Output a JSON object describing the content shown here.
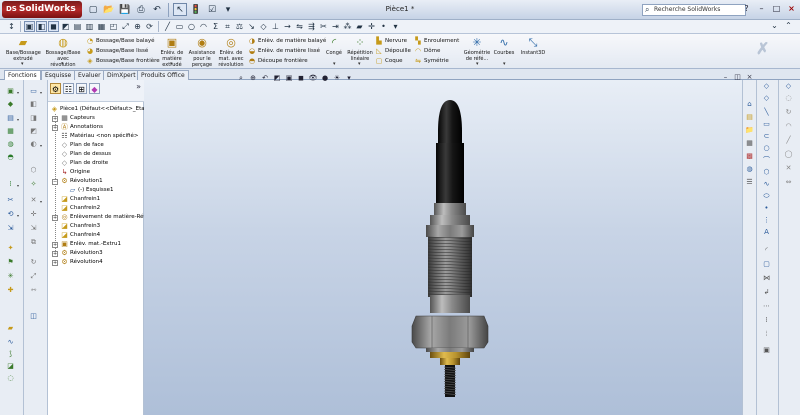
{
  "app": {
    "logo_text": "SolidWorks",
    "logo_mark": "DS",
    "document_title": "Pièce1 *",
    "search_placeholder": "Recherche SolidWorks",
    "window_buttons": {
      "help": "?",
      "minimize": "–",
      "restore": "□",
      "close": "×"
    }
  },
  "ribbon": {
    "big_buttons": [
      {
        "id": "boss-extrude",
        "label": "Base/Bossage extrudé",
        "icon": "boss-extrude-icon"
      },
      {
        "id": "boss-revolve",
        "label": "Bossage/Base avec révolution",
        "icon": "boss-revolve-icon"
      },
      {
        "id": "cut-extrude",
        "label": "Enlév. de matière extrudé",
        "icon": "cut-extrude-icon"
      },
      {
        "id": "hole-wizard",
        "label": "Assistance pour le perçage",
        "icon": "hole-wizard-icon"
      },
      {
        "id": "cut-revolve",
        "label": "Enlèv. de mat. avec révolution",
        "icon": "cut-revolve-icon"
      },
      {
        "id": "fillet",
        "label": "Congé",
        "icon": "fillet-icon"
      },
      {
        "id": "linear-pattern",
        "label": "Répétition linéaire",
        "icon": "linear-pattern-icon"
      },
      {
        "id": "ref-geometry",
        "label": "Géométrie de réfé...",
        "icon": "ref-geometry-icon"
      },
      {
        "id": "curves",
        "label": "Courbes",
        "icon": "curves-icon"
      },
      {
        "id": "instant3d",
        "label": "Instant3D",
        "icon": "instant3d-icon"
      }
    ],
    "small_buttons": [
      {
        "id": "boss-sweep",
        "label": "Bossage/Base balayé"
      },
      {
        "id": "boss-loft",
        "label": "Bossage/Base lissé"
      },
      {
        "id": "boss-boundary",
        "label": "Bossage/Base frontière"
      },
      {
        "id": "cut-sweep",
        "label": "Enlèv. de matière balayé"
      },
      {
        "id": "cut-loft",
        "label": "Enlèv. de matière lissé"
      },
      {
        "id": "cut-boundary",
        "label": "Découpe frontière"
      },
      {
        "id": "rib",
        "label": "Nervure"
      },
      {
        "id": "draft",
        "label": "Dépouille"
      },
      {
        "id": "shell",
        "label": "Coque"
      },
      {
        "id": "wrap",
        "label": "Enroulement"
      },
      {
        "id": "dome",
        "label": "Dôme"
      },
      {
        "id": "mirror",
        "label": "Symétrie"
      }
    ]
  },
  "tabs": [
    "Fonctions",
    "Esquisse",
    "Evaluer",
    "DimXpert",
    "Produits Office"
  ],
  "feature_tree": {
    "root": "Pièce1  (Défaut<<Défaut>_Etat",
    "nodes": [
      {
        "label": "Capteurs",
        "icon": "sensors-icon"
      },
      {
        "label": "Annotations",
        "icon": "annotations-icon"
      },
      {
        "label": "Matériau <non spécifié>",
        "icon": "material-icon"
      },
      {
        "label": "Plan de face",
        "icon": "plane-icon"
      },
      {
        "label": "Plan de dessus",
        "icon": "plane-icon"
      },
      {
        "label": "Plan de droite",
        "icon": "plane-icon"
      },
      {
        "label": "Origine",
        "icon": "origin-icon"
      },
      {
        "label": "Révolution1",
        "icon": "revolve-icon"
      },
      {
        "label": "(-) Esquisse1",
        "icon": "sketch-icon"
      },
      {
        "label": "Chanfrein1",
        "icon": "chamfer-icon"
      },
      {
        "label": "Chanfrein2",
        "icon": "chamfer-icon"
      },
      {
        "label": "Enlèvement de matière-Révo",
        "icon": "cut-revolve-icon"
      },
      {
        "label": "Chanfrein3",
        "icon": "chamfer-icon"
      },
      {
        "label": "Chanfrein4",
        "icon": "chamfer-icon"
      },
      {
        "label": "Enlèv. mat.-Extru1",
        "icon": "cut-extrude-icon"
      },
      {
        "label": "Révolution3",
        "icon": "revolve-icon"
      },
      {
        "label": "Révolution4",
        "icon": "revolve-icon"
      }
    ]
  },
  "colors": {
    "viewport_top": "#e8eef6",
    "viewport_bottom": "#aebfd8",
    "part_body": "#8c8c8c",
    "part_tip": "#1a1a1a",
    "washer": "#b8932e"
  }
}
